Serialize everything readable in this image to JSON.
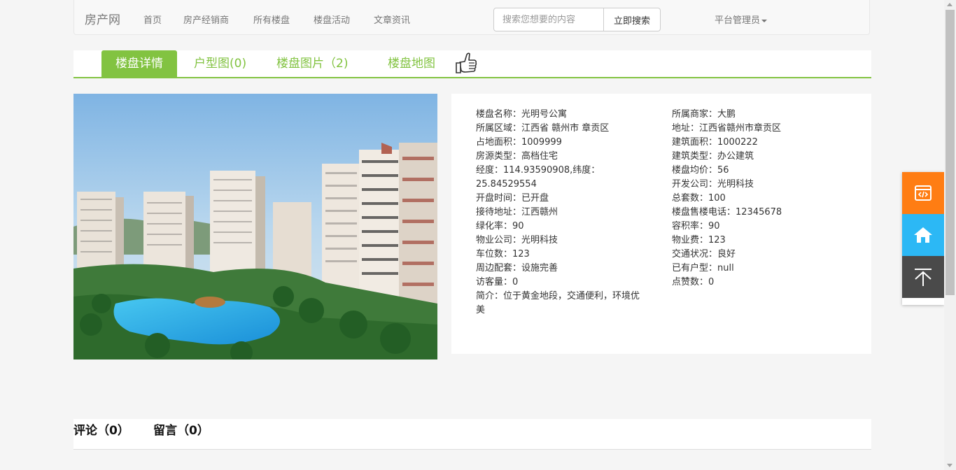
{
  "navbar": {
    "brand": "房产网",
    "items": [
      "首页",
      "房产经销商",
      "所有楼盘",
      "楼盘活动",
      "文章资讯"
    ],
    "search": {
      "placeholder": "搜索您想要的内容",
      "button": "立即搜索"
    },
    "user": "平台管理员"
  },
  "tabs": [
    "楼盘详情",
    "户型图(0)",
    "楼盘图片（2)",
    "楼盘地图"
  ],
  "details_left": [
    "楼盘名称：光明号公寓",
    "所属区域：江西省 赣州市 章贡区",
    "占地面积：1009999",
    "房源类型：高档住宅",
    "经度：114.93590908,纬度：25.84529554",
    "开盘时间：已开盘",
    "接待地址：江西赣州",
    "绿化率：90",
    "物业公司：光明科技",
    "车位数：123",
    "周边配套：设施完善",
    "访客量：0",
    "简介：位于黄金地段，交通便利，环境优美"
  ],
  "details_right": [
    "所属商家：大鹏",
    "地址：江西省赣州市章贡区",
    "建筑面积：1000222",
    "建筑类型：办公建筑",
    "楼盘均价：56",
    "开发公司：光明科技",
    "总套数：100",
    "楼盘售楼电话：12345678",
    "容积率：90",
    "物业费：123",
    "交通状况：良好",
    "已有户型：null",
    "点赞数：0"
  ],
  "comments": {
    "comment_tab": "评论（0）",
    "message_tab": "留言（0）"
  },
  "colors": {
    "accent": "#82c341",
    "orange": "#ff7d13",
    "blue": "#2cb8f5",
    "dark": "#4a4a4a"
  },
  "side_icons": [
    "code-window-icon",
    "home-icon",
    "back-to-top-icon"
  ]
}
